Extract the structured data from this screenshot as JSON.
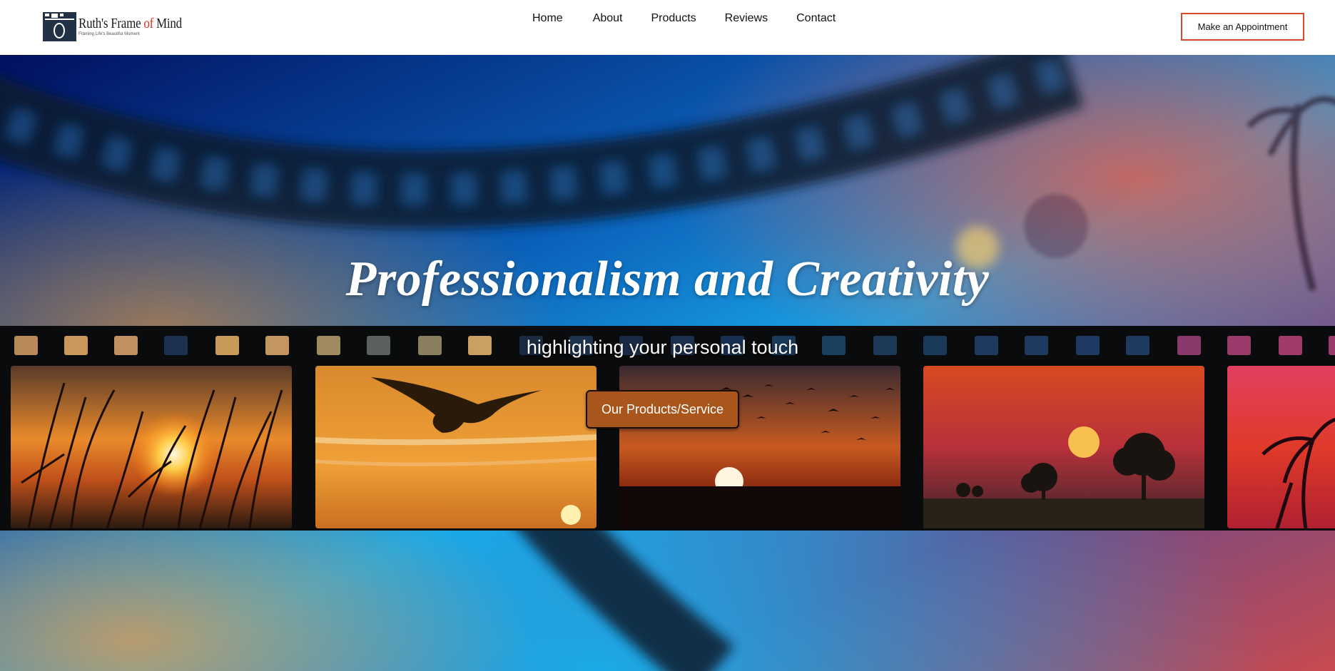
{
  "header": {
    "logo": {
      "name_part1": "Ruth's Frame ",
      "name_of": "of",
      "name_part2": " Mind",
      "tagline": "Framing Life's Beautiful Moment"
    },
    "nav": [
      {
        "label": "Home"
      },
      {
        "label": "About"
      },
      {
        "label": "Products"
      },
      {
        "label": "Reviews"
      },
      {
        "label": "Contact"
      }
    ],
    "appointment_button": "Make an Appointment"
  },
  "hero": {
    "title": "Professionalism and Creativity",
    "subtitle": "highlighting your personal touch",
    "cta_label": "Our Products/Service",
    "background_image": "film-strip-with-sunset-photos",
    "frames": [
      "sunset-through-grass",
      "seagull-at-sunset",
      "birds-over-sunset",
      "savanna-sunset-trees",
      "palm-trees-sunset"
    ]
  },
  "colors": {
    "accent_border": "#d9482a",
    "cta_background": "#a8561b",
    "logo_of": "#d9301f"
  }
}
